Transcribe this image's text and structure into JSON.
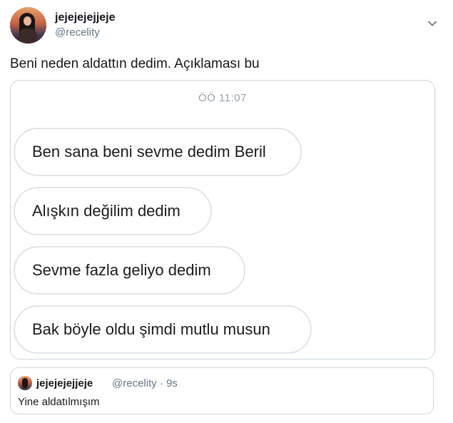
{
  "author": {
    "name": "jejejejejjeje",
    "handle": "@recelity",
    "avatar_icon": "profile-avatar"
  },
  "tweet": {
    "text": "Beni neden aldattın dedim. Açıklaması bu",
    "more_icon": "chevron-down-icon"
  },
  "chat_image": {
    "timestamp": "ÖÖ 11:07",
    "messages": [
      "Ben sana beni sevme dedim Beril",
      "Alışkın değilim dedim",
      "Sevme fazla geliyo dedim",
      "Bak böyle oldu şimdi mutlu musun"
    ]
  },
  "quoted_tweet": {
    "name": "jejejejejjeje",
    "meta": "@recelity · 9s",
    "text": "Yine aldatılmışım"
  },
  "colors": {
    "text": "#14171a",
    "secondary": "#657786",
    "border": "#ccd6dd",
    "bubble_border": "#e1e4e8"
  }
}
